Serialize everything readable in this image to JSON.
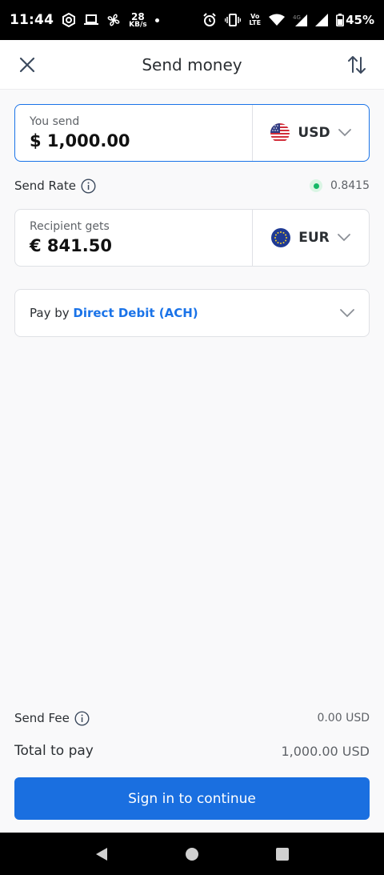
{
  "status_bar": {
    "time": "11:44",
    "net_speed_value": "28",
    "net_speed_unit": "KB/s",
    "volte_top": "Vo",
    "volte_bottom": "LTE",
    "network": "4G",
    "battery": "45%"
  },
  "header": {
    "title": "Send money"
  },
  "send": {
    "label": "You send",
    "amount": "$ 1,000.00",
    "currency": "USD"
  },
  "rate": {
    "label": "Send Rate",
    "value": "0.8415"
  },
  "receive": {
    "label": "Recipient gets",
    "amount": "€ 841.50",
    "currency": "EUR"
  },
  "payment": {
    "prefix": "Pay by",
    "method": "Direct Debit (ACH)"
  },
  "summary": {
    "fee_label": "Send Fee",
    "fee_value": "0.00 USD",
    "total_label": "Total to pay",
    "total_value": "1,000.00 USD"
  },
  "cta": {
    "label": "Sign in to continue"
  },
  "colors": {
    "accent": "#1a73e8",
    "live": "#14b866"
  }
}
